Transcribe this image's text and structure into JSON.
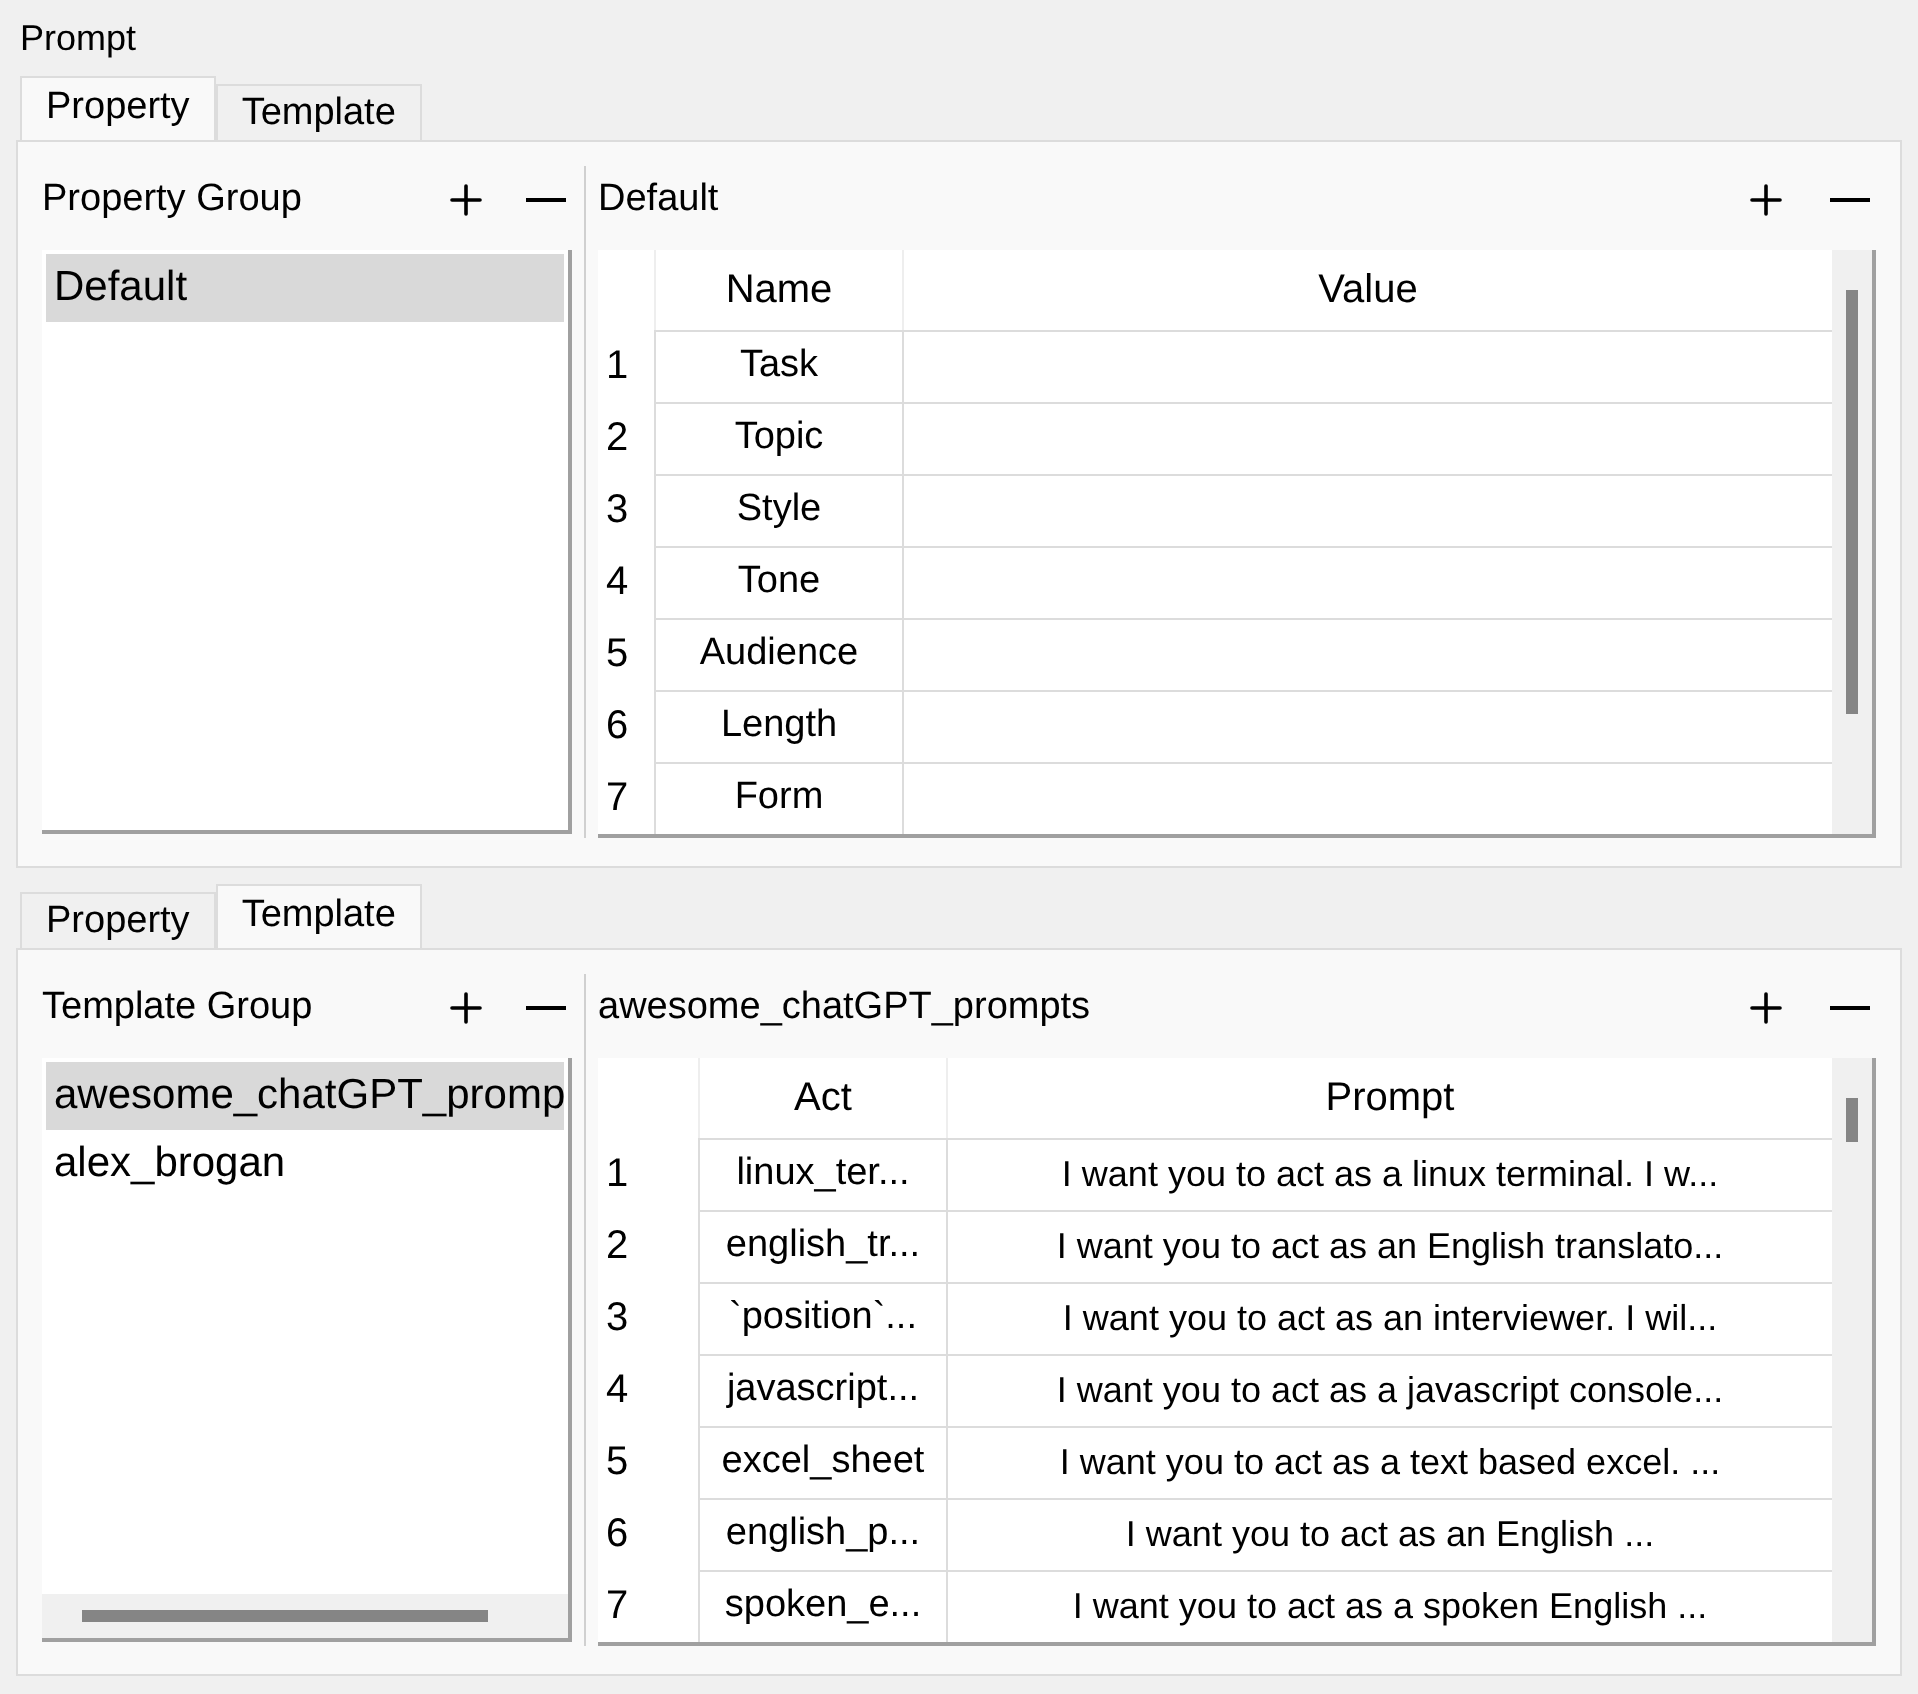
{
  "window": {
    "title": "Prompt"
  },
  "panels": [
    {
      "tabs": [
        {
          "label": "Property",
          "selected": true
        },
        {
          "label": "Template",
          "selected": false
        }
      ],
      "group": {
        "title": "Property Group",
        "items": [
          {
            "label": "Default",
            "selected": true
          }
        ]
      },
      "table": {
        "title": "Default",
        "columns": [
          "Name",
          "Value"
        ],
        "rows": [
          {
            "number": "1",
            "cells": [
              "Task"
            ]
          },
          {
            "number": "2",
            "cells": [
              "Topic"
            ]
          },
          {
            "number": "3",
            "cells": [
              "Style"
            ]
          },
          {
            "number": "4",
            "cells": [
              "Tone"
            ]
          },
          {
            "number": "5",
            "cells": [
              "Audience"
            ]
          },
          {
            "number": "6",
            "cells": [
              "Length"
            ]
          },
          {
            "number": "7",
            "cells": [
              "Form"
            ]
          }
        ]
      }
    },
    {
      "tabs": [
        {
          "label": "Property",
          "selected": false
        },
        {
          "label": "Template",
          "selected": true
        }
      ],
      "group": {
        "title": "Template Group",
        "items": [
          {
            "label": "awesome_chatGPT_promp",
            "selected": true
          },
          {
            "label": "alex_brogan",
            "selected": false
          }
        ]
      },
      "table": {
        "title": "awesome_chatGPT_prompts",
        "columns": [
          "Act",
          "Prompt"
        ],
        "rows": [
          {
            "number": "1",
            "cells": [
              "linux_ter...",
              "I want you to act as a linux terminal. I w..."
            ]
          },
          {
            "number": "2",
            "cells": [
              "english_tr...",
              "I want you to act as an English translato..."
            ]
          },
          {
            "number": "3",
            "cells": [
              "`position`...",
              "I want you to act as an interviewer. I wil..."
            ]
          },
          {
            "number": "4",
            "cells": [
              "javascript...",
              "I want you to act as a javascript console..."
            ]
          },
          {
            "number": "5",
            "cells": [
              "excel_sheet",
              "I want you to act as a text based excel. ..."
            ]
          },
          {
            "number": "6",
            "cells": [
              "english_p...",
              "I want you to act as an English ..."
            ]
          },
          {
            "number": "7",
            "cells": [
              "spoken_e...",
              "I want you to act as a spoken English ..."
            ]
          }
        ]
      }
    }
  ]
}
